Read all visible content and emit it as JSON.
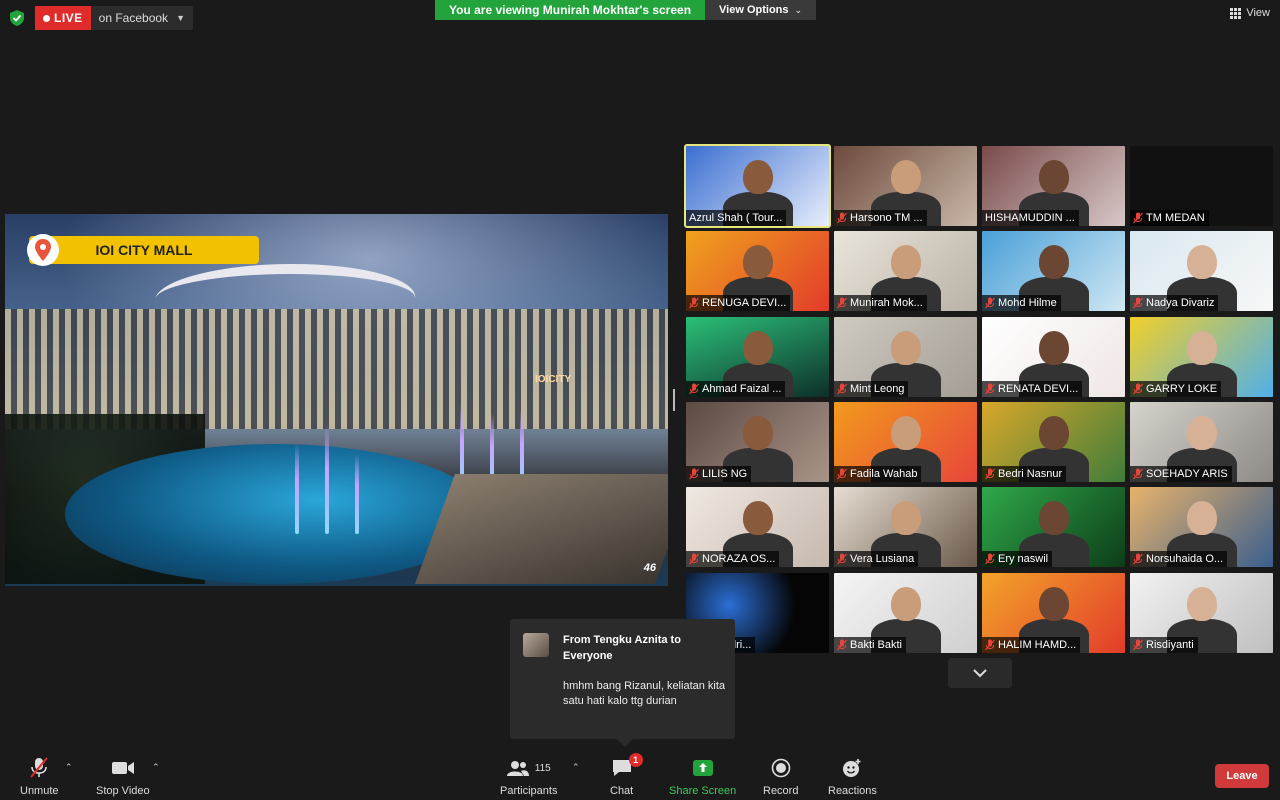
{
  "topbar": {
    "live_label": "LIVE",
    "platform": "on Facebook",
    "viewing_banner": "You are viewing Munirah Mokhtar's screen",
    "view_options": "View Options",
    "view_label": "View"
  },
  "shared_screen": {
    "location_label": "IOI CITY MALL",
    "building_sign": "IOICITY",
    "slide_number": "46"
  },
  "participants": [
    {
      "name": "Azrul Shah ( Tour...",
      "muted": false,
      "active": true
    },
    {
      "name": "Harsono TM ...",
      "muted": true
    },
    {
      "name": "HISHAMUDDIN ...",
      "muted": false
    },
    {
      "name": "TM MEDAN",
      "muted": true
    },
    {
      "name": "RENUGA DEVI...",
      "muted": true
    },
    {
      "name": "Munirah Mok...",
      "muted": true
    },
    {
      "name": "Mohd Hilme",
      "muted": true
    },
    {
      "name": "Nadya Divariz",
      "muted": true
    },
    {
      "name": "Ahmad Faizal ...",
      "muted": true
    },
    {
      "name": "Mint Leong",
      "muted": true
    },
    {
      "name": "RENATA DEVI...",
      "muted": true
    },
    {
      "name": "GARRY LOKE",
      "muted": true
    },
    {
      "name": "LILIS NG",
      "muted": true
    },
    {
      "name": "Fadila Wahab",
      "muted": true
    },
    {
      "name": "Bedri Nasnur",
      "muted": true
    },
    {
      "name": "SOEHADY ARIS",
      "muted": true
    },
    {
      "name": "NORAZA OS...",
      "muted": true
    },
    {
      "name": "Vera Lusiana",
      "muted": true
    },
    {
      "name": "Ery naswil",
      "muted": true
    },
    {
      "name": "Norsuhaida O...",
      "muted": true
    },
    {
      "name": "...uswandri...",
      "muted": false
    },
    {
      "name": "Bakti Bakti",
      "muted": true
    },
    {
      "name": "HALIM HAMD...",
      "muted": true
    },
    {
      "name": "Risdiyanti",
      "muted": true
    }
  ],
  "chat": {
    "from": "From Tengku Aznita to Everyone",
    "message": "hmhm bang Rizanul, keliatan kita satu hati kalo ttg durian"
  },
  "toolbar": {
    "unmute": "Unmute",
    "stop_video": "Stop Video",
    "participants": "Participants",
    "participants_count": "115",
    "chat": "Chat",
    "chat_badge": "1",
    "share_screen": "Share Screen",
    "record": "Record",
    "reactions": "Reactions",
    "leave": "Leave"
  },
  "colors": {
    "live_red": "#e02b2b",
    "share_green": "#22a33b",
    "active_speaker": "#e6e67a",
    "leave_red": "#d03a3a"
  }
}
